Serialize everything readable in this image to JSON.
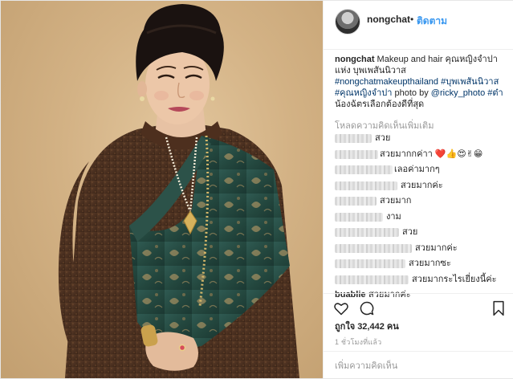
{
  "header": {
    "username": "nongchat",
    "separator": "•",
    "follow_label": "ติดตาม"
  },
  "caption": {
    "username": "nongchat",
    "text": " Makeup and hair คุณหญิงจำปา แห่ง บุพเพสันนิวาส ",
    "tag1": "#nongchatmakeupthailand",
    "tag2": " #บุพเพสันนิวาส",
    "tag3": "#คุณหญิงจำปา",
    "text2": " photo by ",
    "mention": "@ricky_photo",
    "tag4": " #ต๋า",
    "text3": "น้องฉัตรเลือกต้องดีที่สุด"
  },
  "load_more_label": "โหลดความคิดเห็นเพิ่มเติม",
  "comments": [
    {
      "user": "",
      "text": "สวย"
    },
    {
      "user": "",
      "text": "สวยมากกค่าา ❤️👍😍✌😁"
    },
    {
      "user": "",
      "text": "เลอค่ามากๆ"
    },
    {
      "user": "",
      "text": "สวยมากค่ะ"
    },
    {
      "user": "",
      "text": "สวยมาก"
    },
    {
      "user": "",
      "text": "งาม"
    },
    {
      "user": "",
      "text": "สวย"
    },
    {
      "user": "",
      "text": "สวยมากค่ะ"
    },
    {
      "user": "",
      "text": "สวยมากซะ"
    },
    {
      "user": "",
      "text": "สวยมากระไรเยี่ยงนี้ค่ะ"
    },
    {
      "user": "buablie",
      "text": "สวยมากค่ะ"
    }
  ],
  "actions": {
    "like_icon": "heart-icon",
    "comment_icon": "comment-bubble-icon",
    "save_icon": "bookmark-icon"
  },
  "likes_label": "ถูกใจ 32,442 คน",
  "time_label": "1 ชั่วโมงที่แล้ว",
  "add_comment_placeholder": "เพิ่มความคิดเห็น"
}
